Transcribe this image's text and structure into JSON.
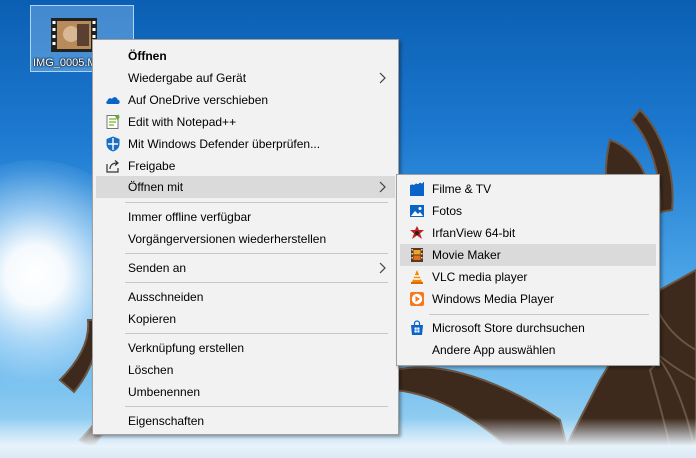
{
  "desktop": {
    "icon_label": "IMG_0005.M"
  },
  "context_menu": {
    "items": [
      {
        "label": "Öffnen",
        "bold": true
      },
      {
        "label": "Wiedergabe auf Gerät",
        "submenu": true
      },
      {
        "label": "Auf OneDrive verschieben",
        "icon": "onedrive-icon"
      },
      {
        "label": "Edit with Notepad++",
        "icon": "notepad-plus-plus-icon"
      },
      {
        "label": "Mit Windows Defender überprüfen...",
        "icon": "windows-defender-icon"
      },
      {
        "label": "Freigabe",
        "icon": "share-icon"
      },
      {
        "label": "Öffnen mit",
        "submenu": true,
        "highlighted": true
      },
      {
        "label": "Immer offline verfügbar"
      },
      {
        "label": "Vorgängerversionen wiederherstellen"
      },
      {
        "label": "Senden an",
        "submenu": true
      },
      {
        "label": "Ausschneiden"
      },
      {
        "label": "Kopieren"
      },
      {
        "label": "Verknüpfung erstellen"
      },
      {
        "label": "Löschen"
      },
      {
        "label": "Umbenennen"
      },
      {
        "label": "Eigenschaften"
      }
    ]
  },
  "open_with_submenu": {
    "items": [
      {
        "label": "Filme & TV",
        "icon": "films-tv-icon"
      },
      {
        "label": "Fotos",
        "icon": "photos-icon"
      },
      {
        "label": "IrfanView 64-bit",
        "icon": "irfanview-icon"
      },
      {
        "label": "Movie Maker",
        "icon": "movie-maker-icon",
        "highlighted": true
      },
      {
        "label": "VLC media player",
        "icon": "vlc-icon"
      },
      {
        "label": "Windows Media Player",
        "icon": "windows-media-player-icon"
      },
      {
        "label": "Microsoft Store durchsuchen",
        "icon": "microsoft-store-icon"
      },
      {
        "label": "Andere App auswählen"
      }
    ]
  },
  "colors": {
    "menu_background": "#f2f2f2",
    "menu_highlight": "#dadada",
    "separator": "#c8c8c8",
    "accent_blue": "#0078d7"
  }
}
